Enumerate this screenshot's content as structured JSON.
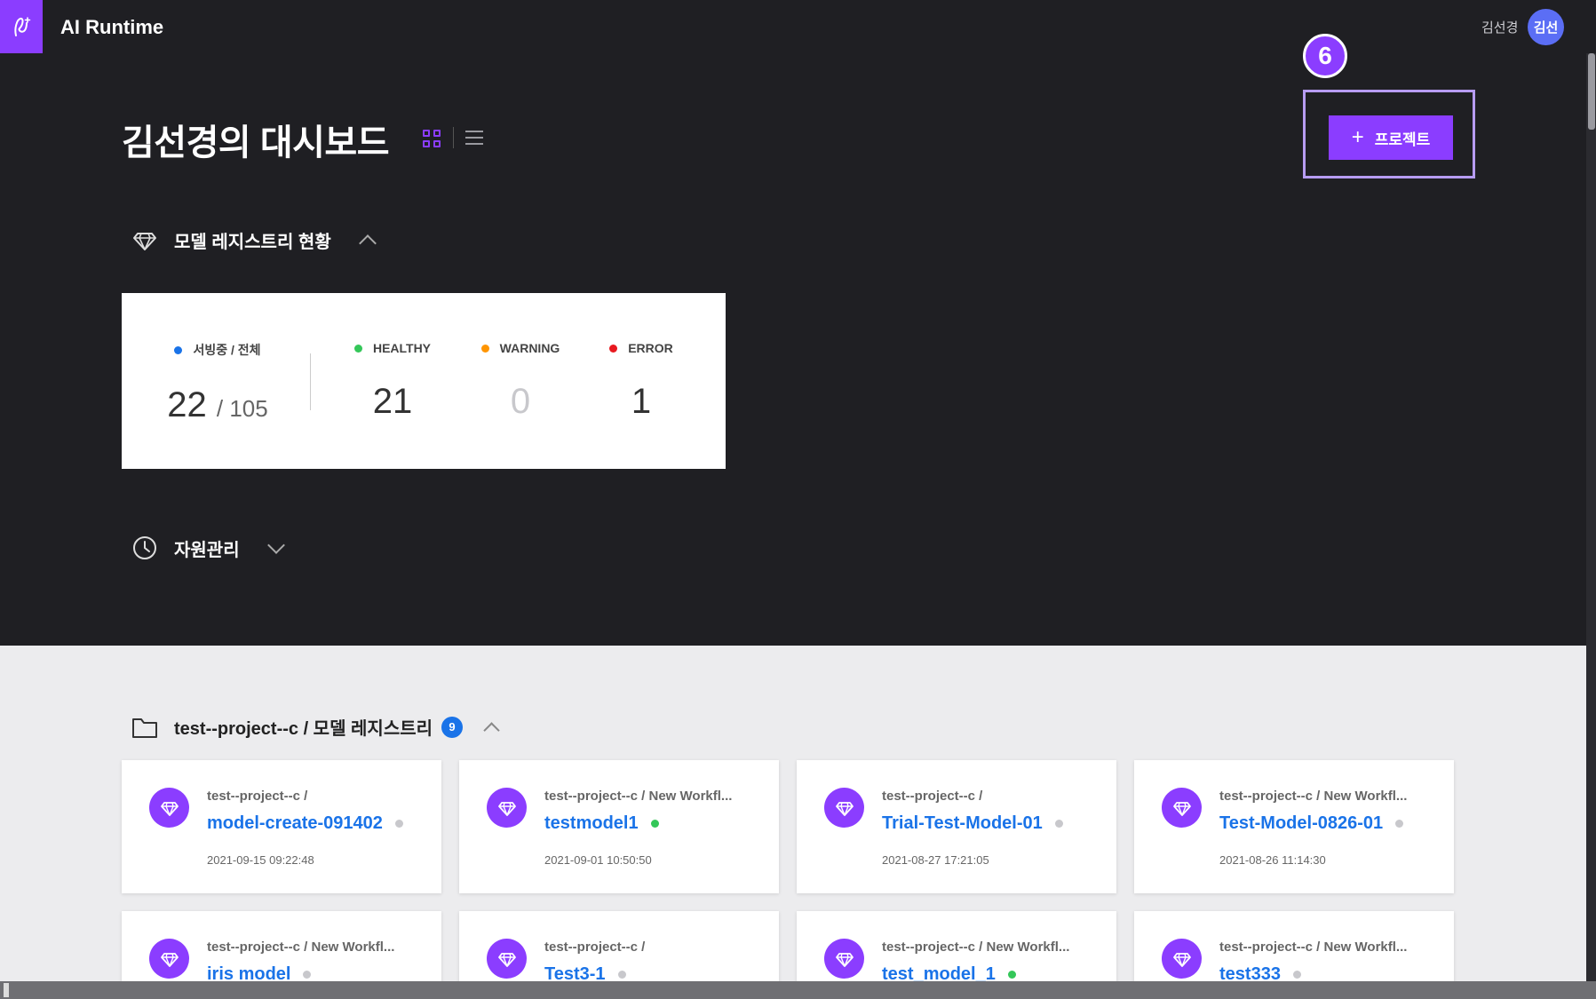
{
  "app": {
    "title": "AI Runtime"
  },
  "user": {
    "name": "김선경",
    "avatar_text": "김선"
  },
  "page": {
    "title": "김선경의 대시보드"
  },
  "annotation": {
    "step": "6"
  },
  "actions": {
    "add_project_label": "프로젝트",
    "add_project_icon": "plus-icon"
  },
  "sections": {
    "model_registry": {
      "title": "모델 레지스트리 현황",
      "icon": "diamond-icon",
      "expanded": true
    },
    "resources": {
      "title": "자원관리",
      "icon": "clock-icon",
      "expanded": false
    }
  },
  "status": {
    "serving": {
      "label": "서빙중 / 전체",
      "value": "22",
      "total": "/ 105",
      "color": "#1a73e8"
    },
    "healthy": {
      "label": "HEALTHY",
      "value": "21",
      "color": "#34c759"
    },
    "warning": {
      "label": "WARNING",
      "value": "0",
      "color": "#ff9500"
    },
    "error": {
      "label": "ERROR",
      "value": "1",
      "color": "#e8191f"
    }
  },
  "project": {
    "title": "test--project--c / 모델 레지스트리",
    "count": "9",
    "models": [
      {
        "path": "test--project--c /",
        "name": "model-create-091402",
        "status": "gray",
        "date": "2021-09-15 09:22:48"
      },
      {
        "path": "test--project--c / New Workfl...",
        "name": "testmodel1",
        "status": "green",
        "date": "2021-09-01 10:50:50"
      },
      {
        "path": "test--project--c /",
        "name": "Trial-Test-Model-01",
        "status": "gray",
        "date": "2021-08-27 17:21:05"
      },
      {
        "path": "test--project--c / New Workfl...",
        "name": "Test-Model-0826-01",
        "status": "gray",
        "date": "2021-08-26 11:14:30"
      },
      {
        "path": "test--project--c / New Workfl...",
        "name": "iris model",
        "status": "gray",
        "date": ""
      },
      {
        "path": "test--project--c /",
        "name": "Test3-1",
        "status": "gray",
        "date": ""
      },
      {
        "path": "test--project--c / New Workfl...",
        "name": "test_model_1",
        "status": "green",
        "date": ""
      },
      {
        "path": "test--project--c / New Workfl...",
        "name": "test333",
        "status": "gray",
        "date": ""
      }
    ]
  },
  "colors": {
    "accent": "#8b3dff",
    "link": "#1a73e8",
    "status_green": "#34c759",
    "status_gray": "#c8c8cc"
  }
}
